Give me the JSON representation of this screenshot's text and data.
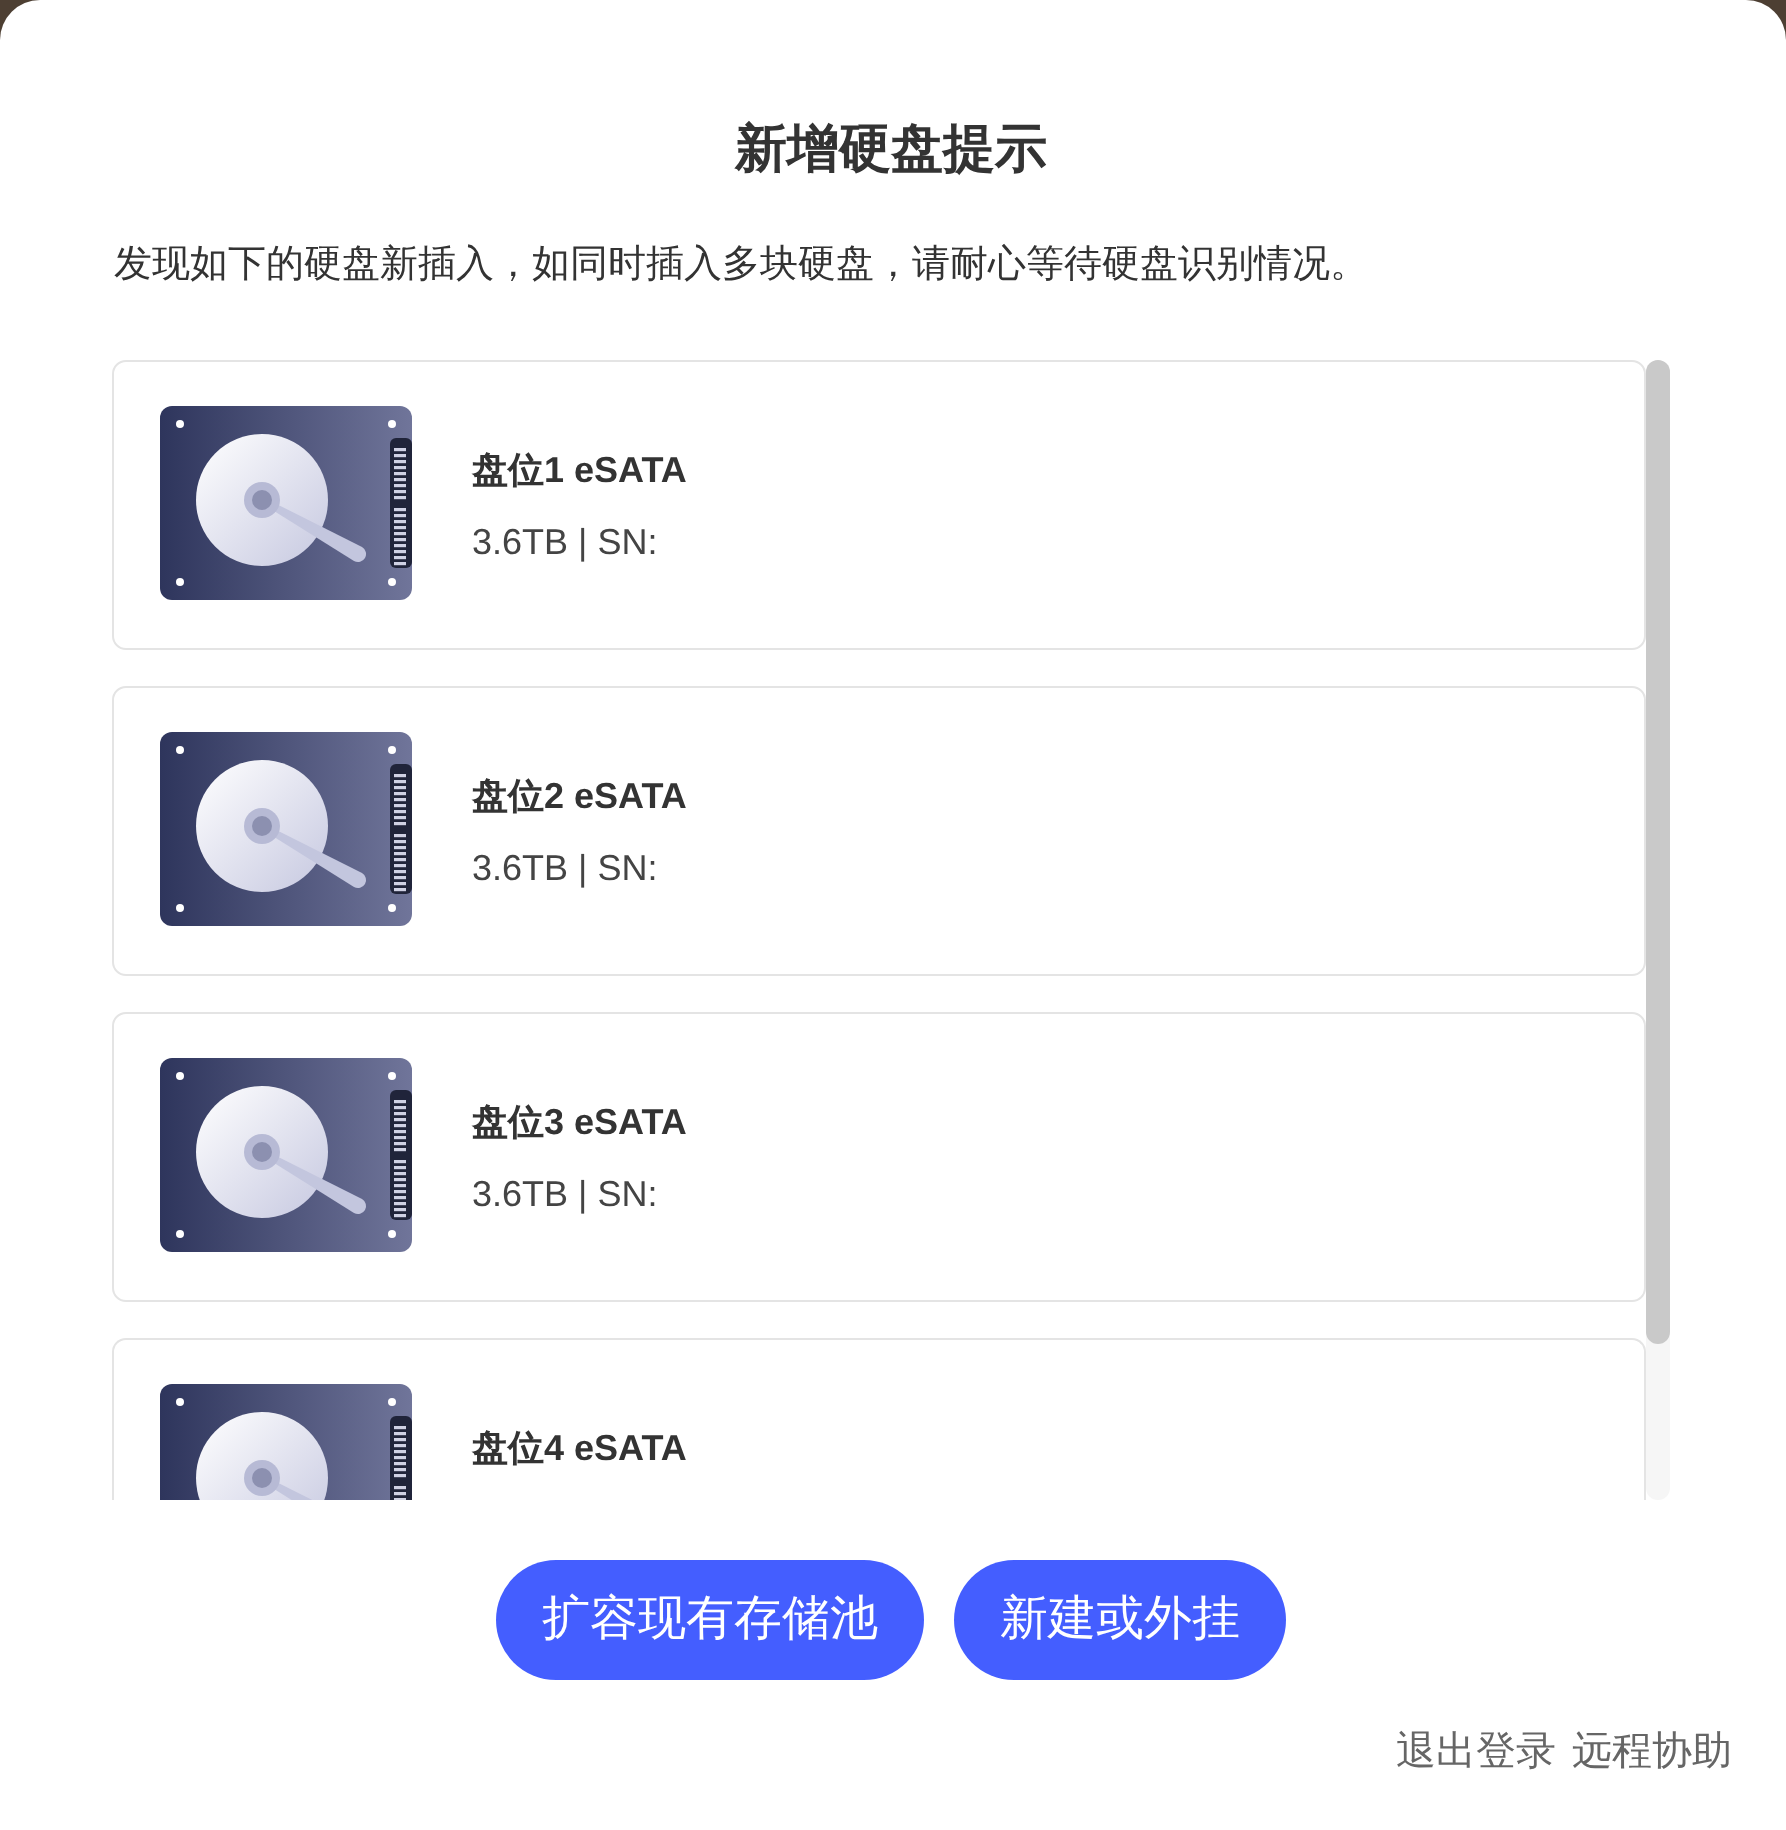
{
  "dialog": {
    "title": "新增硬盘提示",
    "description": "发现如下的硬盘新插入，如同时插入多块硬盘，请耐心等待硬盘识别情况。"
  },
  "disks": [
    {
      "name": "盘位1 eSATA",
      "info": "3.6TB | SN:"
    },
    {
      "name": "盘位2 eSATA",
      "info": "3.6TB | SN:"
    },
    {
      "name": "盘位3 eSATA",
      "info": "3.6TB | SN:"
    },
    {
      "name": "盘位4 eSATA"
    }
  ],
  "buttons": [
    "扩容现有存储池",
    "新建或外挂"
  ],
  "footer_links": [
    "退出登录",
    "远程协助"
  ]
}
